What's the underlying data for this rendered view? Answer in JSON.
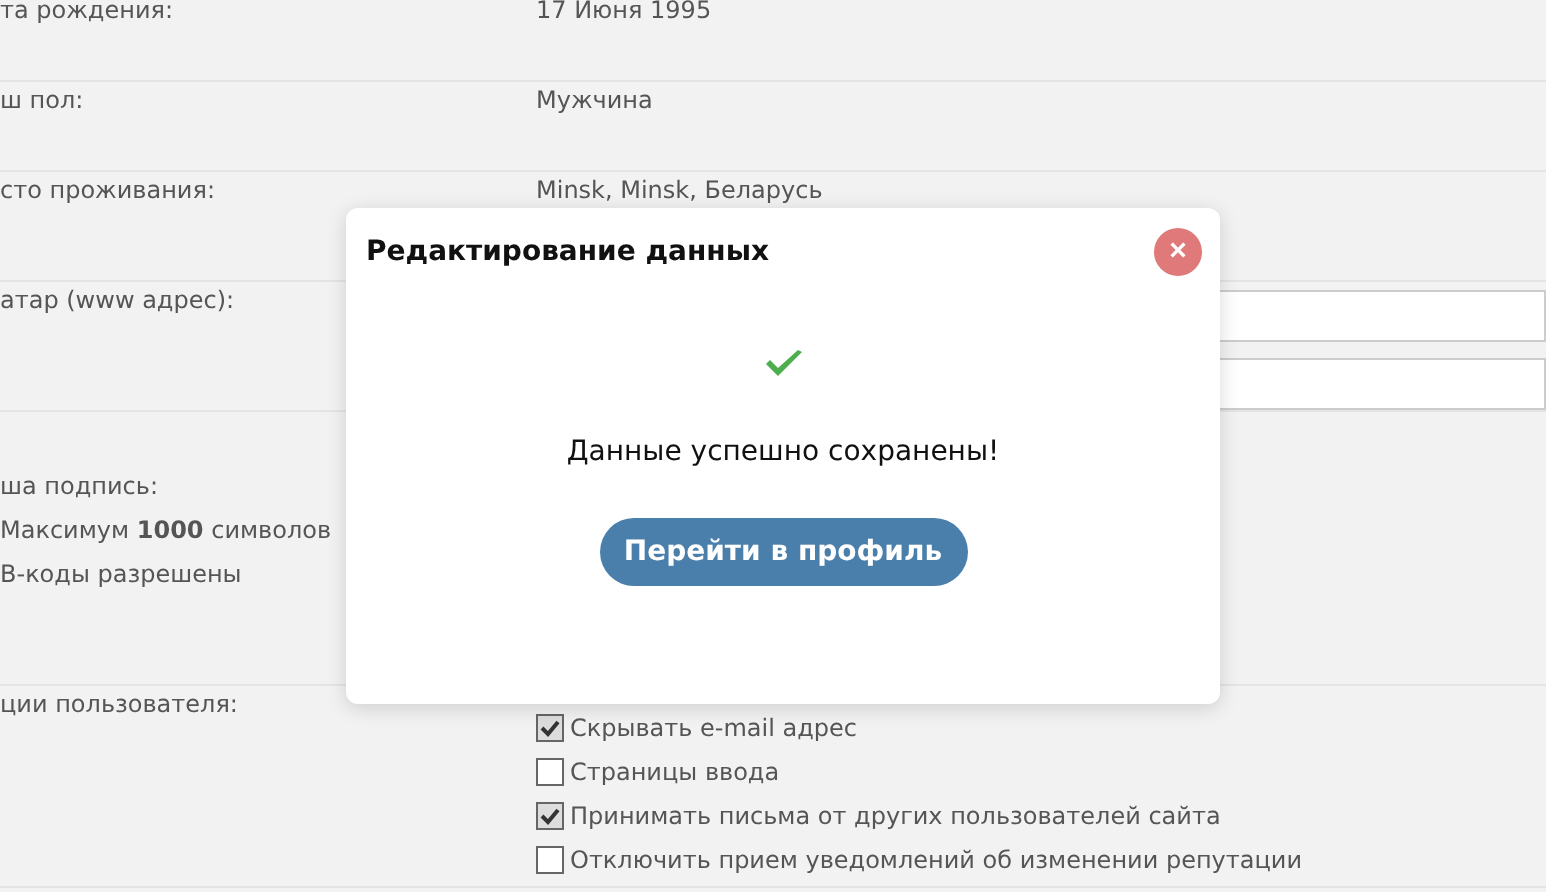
{
  "profile_form": {
    "rows": [
      {
        "kind": "text",
        "label": "та рождения:",
        "value": "17 Июня 1995"
      },
      {
        "kind": "text",
        "label": "ш пол:",
        "value": "Мужчина"
      },
      {
        "kind": "text",
        "label": "сто проживания:",
        "value": "Minsk, Minsk, Беларусь"
      },
      {
        "kind": "fields",
        "label": "атар (www адрес):"
      },
      {
        "kind": "signature",
        "label": "ша подпись:",
        "notes": [
          "Максимум **1000** символов",
          "B-коды разрешены"
        ]
      },
      {
        "kind": "options",
        "label": "ции пользователя:",
        "options": [
          {
            "label": "Скрывать e-mail адрес",
            "checked": true
          },
          {
            "label": "Страницы ввода",
            "checked": false
          },
          {
            "label": "Принимать письма от других пользователей сайта",
            "checked": true
          },
          {
            "label": "Отключить прием уведомлений об изменении репутации",
            "checked": false
          }
        ]
      }
    ]
  },
  "dialog": {
    "title": "Редактирование данных",
    "close": "×",
    "message": "Данные успешно сохранены!",
    "button": "Перейти в профиль"
  }
}
